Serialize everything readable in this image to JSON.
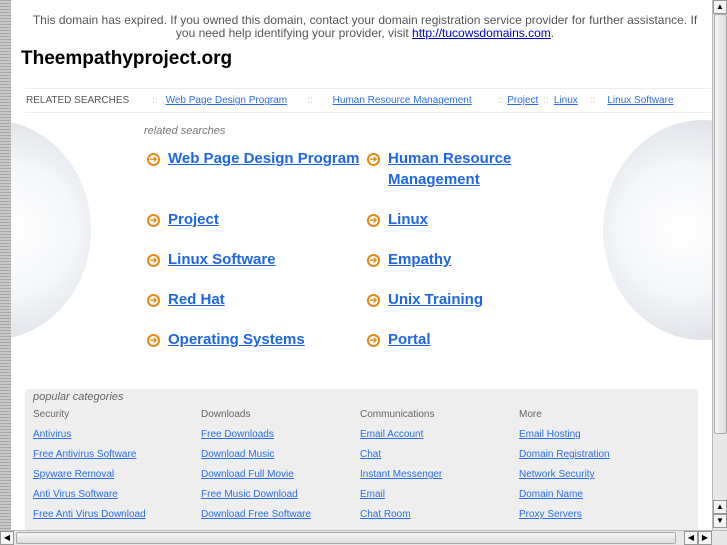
{
  "notice": {
    "text": "This domain has expired. If you owned this domain, contact your domain registration service provider for further assistance. If you need help identifying your provider, visit ",
    "link": "http://tucowsdomains.com",
    "end": "."
  },
  "site_title": "Theempathyproject.org",
  "related_bar": {
    "label": "RELATED SEARCHES",
    "sep": "::",
    "links": [
      "Web Page Design Program",
      "Human Resource Management",
      "Project",
      "Linux",
      "Linux Software"
    ]
  },
  "related": {
    "heading": "related searches",
    "arrow": "➔",
    "items": [
      "Web Page Design Program",
      "Human Resource Management",
      "Project",
      "Linux",
      "Linux Software",
      "Empathy",
      "Red Hat",
      "Unix Training",
      "Operating Systems",
      "Portal"
    ]
  },
  "popular": {
    "heading": "popular categories",
    "columns": [
      {
        "title": "Security",
        "links": [
          "Antivirus",
          "Free Antivirus Software",
          "Spyware Removal",
          "Anti Virus Software",
          "Free Anti Virus Download"
        ]
      },
      {
        "title": "Downloads",
        "links": [
          "Free Downloads",
          "Download Music",
          "Download Full Movie",
          "Free Music Download",
          "Download Free Software"
        ]
      },
      {
        "title": "Communications",
        "links": [
          "Email Account",
          "Chat",
          "Instant Messenger",
          "Email",
          "Chat Room"
        ]
      },
      {
        "title": "More",
        "links": [
          "Email Hosting",
          "Domain Registration",
          "Network Security",
          "Domain Name",
          "Proxy Servers"
        ]
      }
    ]
  },
  "scroll": {
    "up": "▲",
    "down": "▼",
    "left": "◀",
    "right": "▶"
  }
}
